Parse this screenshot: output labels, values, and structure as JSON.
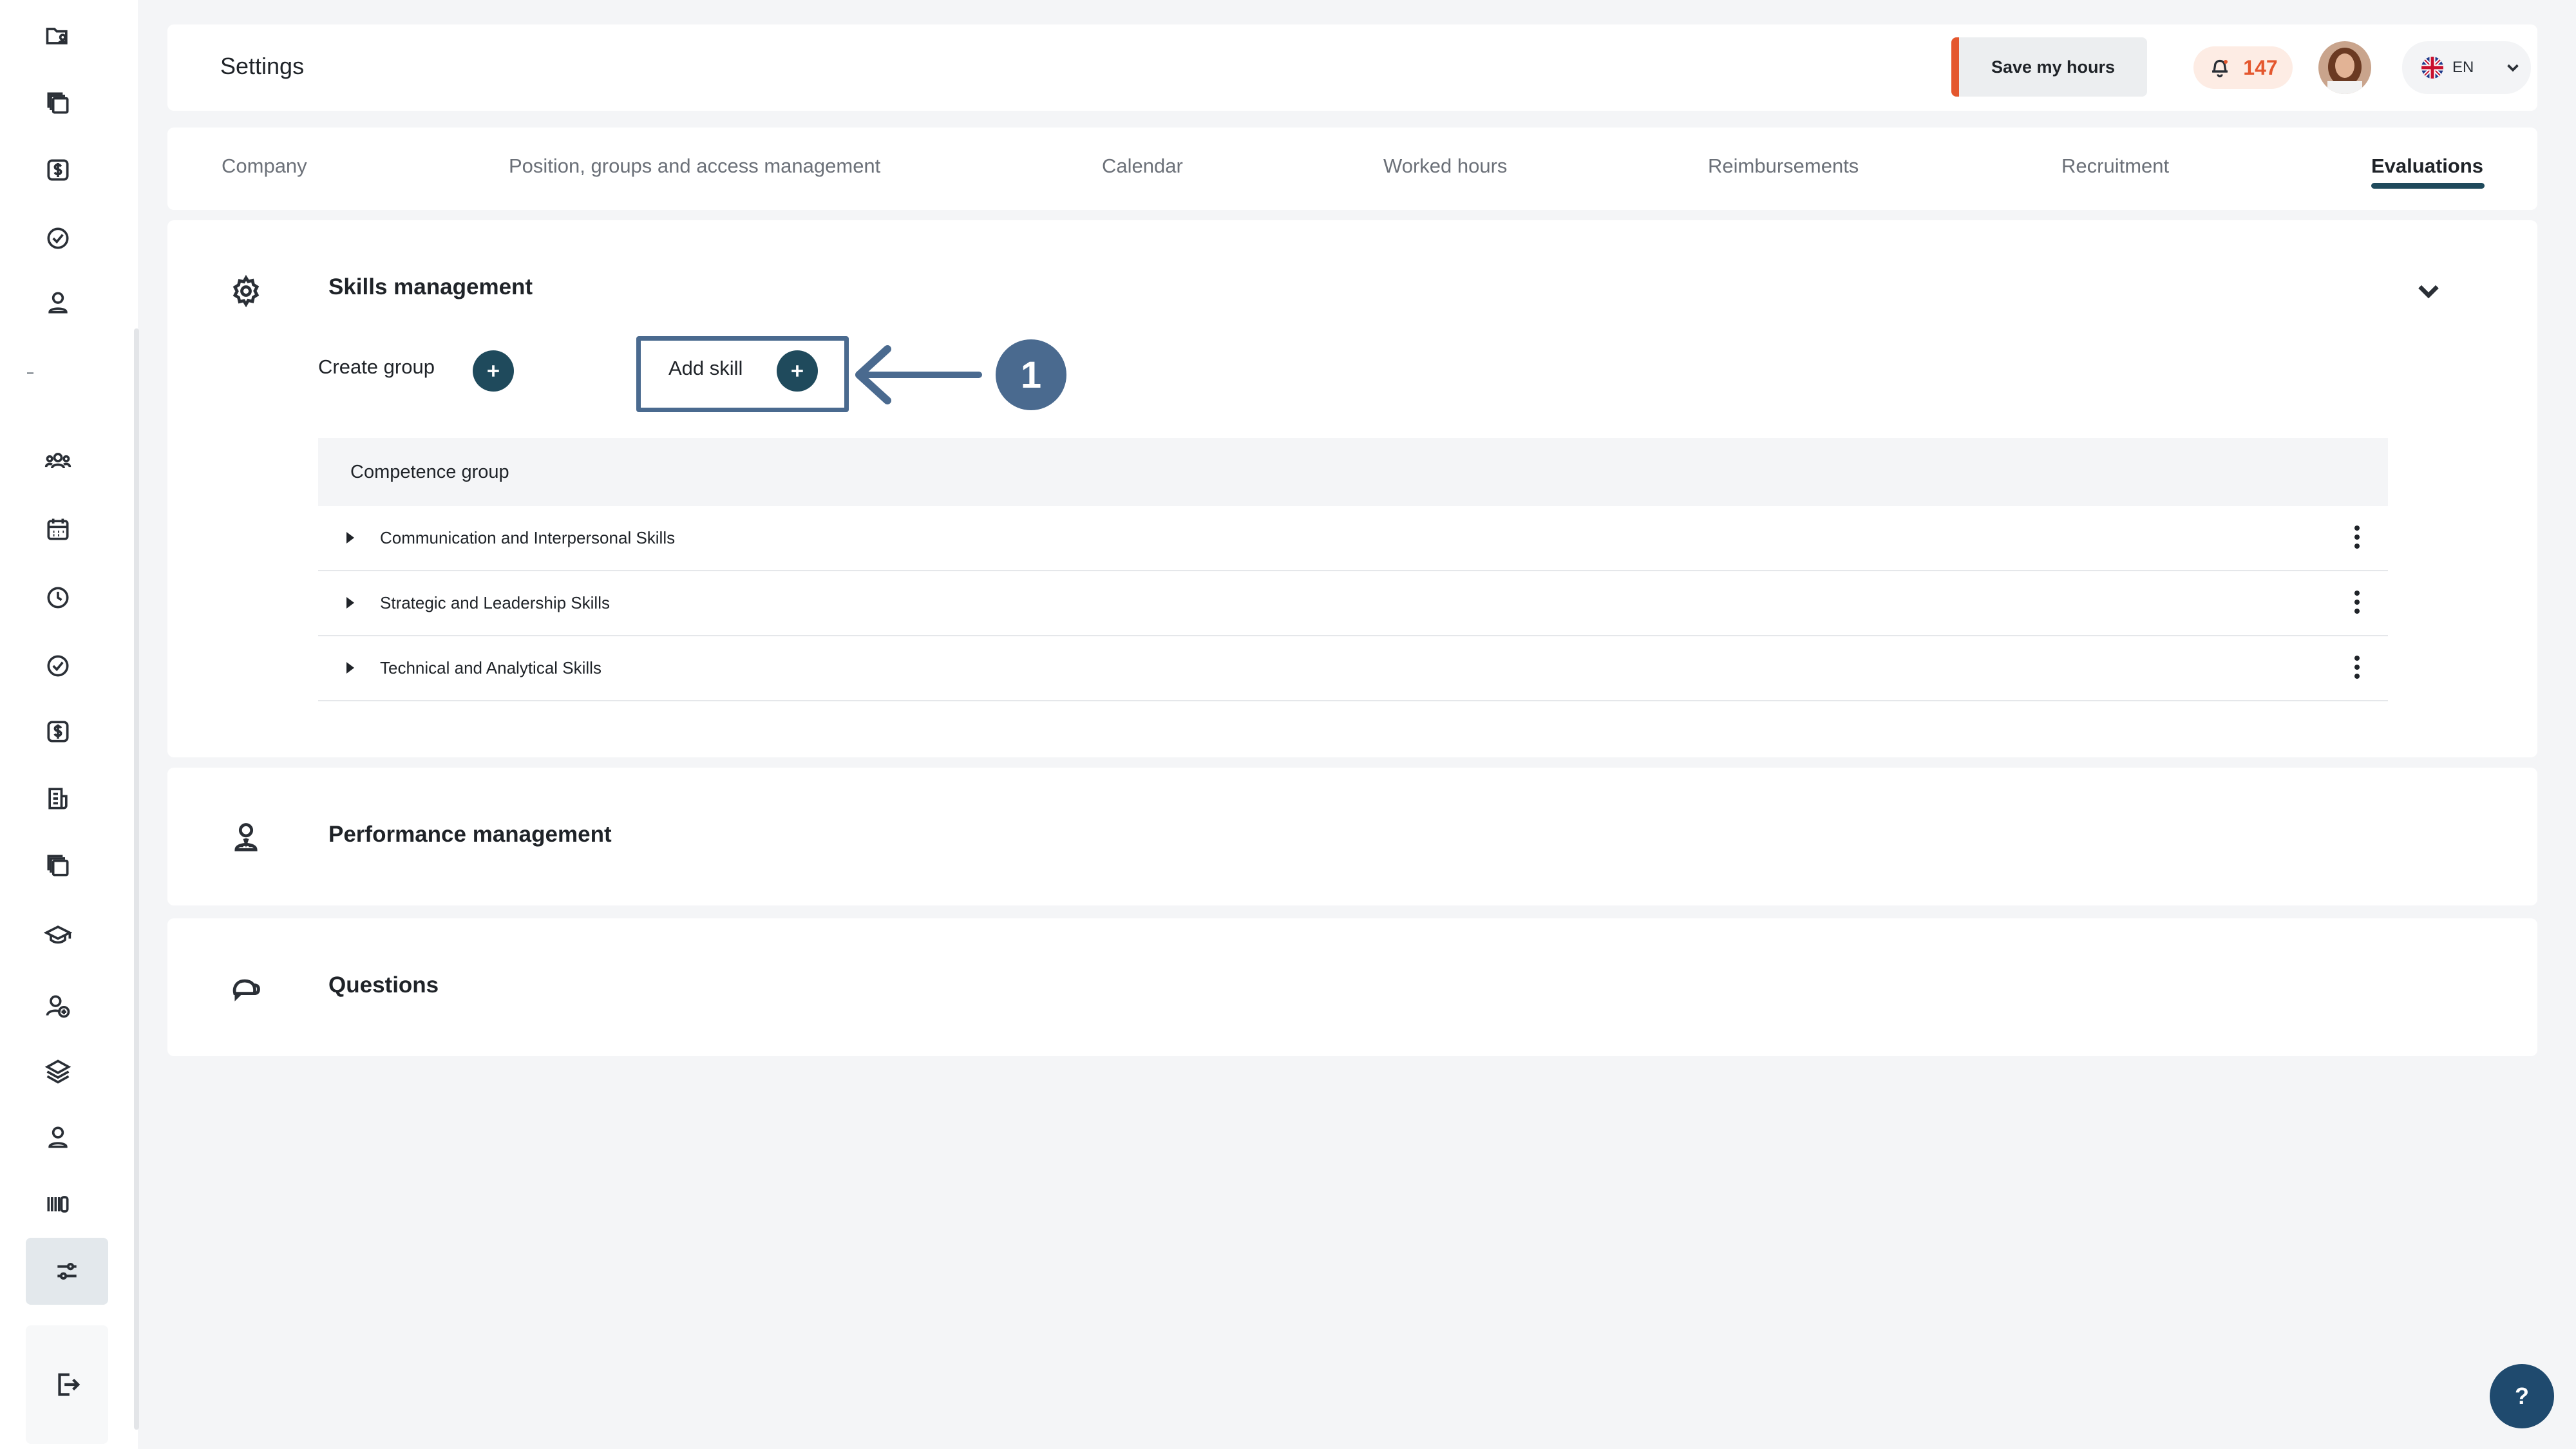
{
  "header": {
    "title": "Settings",
    "save_label": "Save my hours",
    "notification_count": "147",
    "language": "EN"
  },
  "tabs": [
    {
      "label": "Company"
    },
    {
      "label": "Position, groups and access management"
    },
    {
      "label": "Calendar"
    },
    {
      "label": "Worked hours"
    },
    {
      "label": "Reimbursements"
    },
    {
      "label": "Recruitment"
    },
    {
      "label": "Evaluations",
      "active": true
    }
  ],
  "skills_section": {
    "title": "Skills management",
    "create_group_label": "Create group",
    "add_skill_label": "Add skill",
    "callout_number": "1",
    "table_header": "Competence group",
    "rows": [
      {
        "label": "Communication and Interpersonal Skills"
      },
      {
        "label": "Strategic and Leadership Skills"
      },
      {
        "label": "Technical and Analytical Skills"
      }
    ]
  },
  "performance_section": {
    "title": "Performance management"
  },
  "questions_section": {
    "title": "Questions"
  },
  "help": {
    "label": "?"
  },
  "colors": {
    "accent": "#1f4a5c",
    "highlight": "#4a6a8f",
    "save_bar": "#e4572e",
    "notification": "#e4572e"
  },
  "sidebar_icons": [
    "folder-user-icon",
    "copy-icon",
    "dollar-icon",
    "check-circle-icon",
    "user-icon",
    "team-icon",
    "calendar-icon",
    "clock-icon",
    "check-circle-icon",
    "dollar-icon",
    "document-icon",
    "copy-icon",
    "graduation-icon",
    "user-add-icon",
    "layers-icon",
    "user-icon",
    "barcode-icon",
    "sliders-icon",
    "logout-icon"
  ]
}
